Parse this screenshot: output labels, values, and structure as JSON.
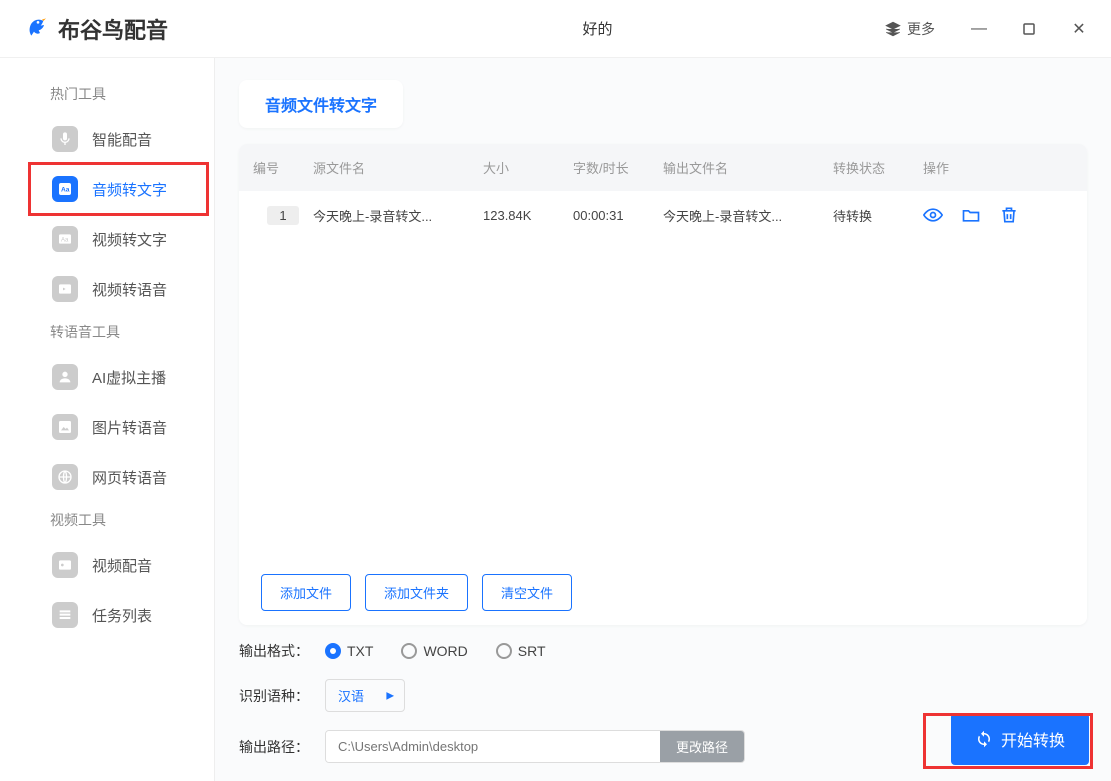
{
  "titlebar": {
    "app_name": "布谷鸟配音",
    "center_text": "好的",
    "more_label": "更多"
  },
  "sidebar": {
    "sections": [
      {
        "title": "热门工具",
        "items": [
          {
            "label": "智能配音",
            "icon": "mic"
          },
          {
            "label": "音频转文字",
            "icon": "audio-text",
            "active": true,
            "highlight": true
          },
          {
            "label": "视频转文字",
            "icon": "video-text"
          },
          {
            "label": "视频转语音",
            "icon": "video-audio"
          }
        ]
      },
      {
        "title": "转语音工具",
        "items": [
          {
            "label": "AI虚拟主播",
            "icon": "ai-avatar"
          },
          {
            "label": "图片转语音",
            "icon": "image-audio"
          },
          {
            "label": "网页转语音",
            "icon": "web-audio"
          }
        ]
      },
      {
        "title": "视频工具",
        "items": [
          {
            "label": "视频配音",
            "icon": "video-dub"
          }
        ]
      },
      {
        "title": "",
        "items": [
          {
            "label": "任务列表",
            "icon": "tasks"
          }
        ]
      }
    ]
  },
  "main": {
    "tab_title": "音频文件转文字",
    "columns": [
      "编号",
      "源文件名",
      "大小",
      "字数/时长",
      "输出文件名",
      "转换状态",
      "操作"
    ],
    "rows": [
      {
        "idx": "1",
        "src_name": "今天晚上-录音转文...",
        "size": "123.84K",
        "duration": "00:00:31",
        "out_name": "今天晚上-录音转文...",
        "status": "待转换"
      }
    ],
    "actions": {
      "add_file": "添加文件",
      "add_folder": "添加文件夹",
      "clear": "清空文件"
    }
  },
  "footer": {
    "format_label": "输出格式：",
    "formats": [
      {
        "label": "TXT",
        "checked": true
      },
      {
        "label": "WORD",
        "checked": false
      },
      {
        "label": "SRT",
        "checked": false
      }
    ],
    "lang_label": "识别语种：",
    "lang_value": "汉语",
    "path_label": "输出路径：",
    "path_placeholder": "C:\\Users\\Admin\\desktop",
    "path_btn": "更改路径",
    "start_btn": "开始转换"
  }
}
